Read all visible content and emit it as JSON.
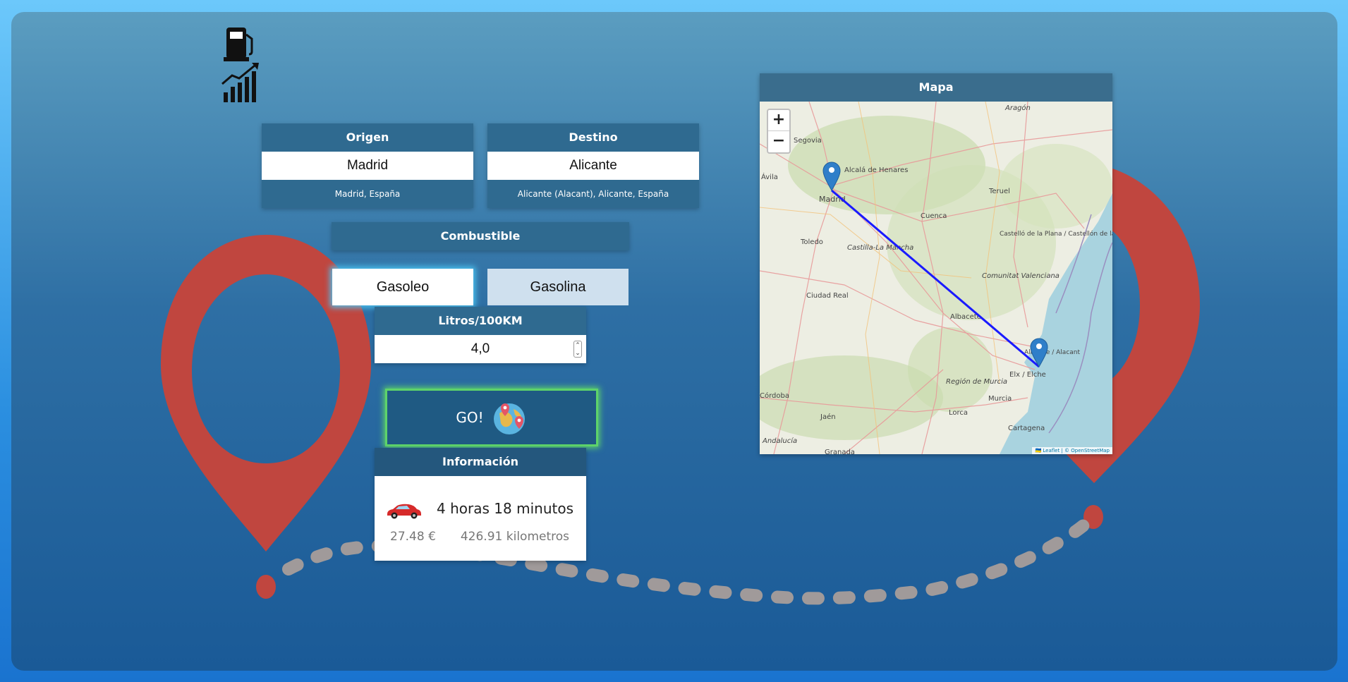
{
  "origin": {
    "heading": "Origen",
    "value": "Madrid",
    "resolved": "Madrid, España"
  },
  "destination": {
    "heading": "Destino",
    "value": "Alicante",
    "resolved": "Alicante (Alacant), Alicante, España"
  },
  "fuel": {
    "heading": "Combustible",
    "options": [
      "Gasoleo",
      "Gasolina"
    ],
    "selected": "Gasoleo"
  },
  "consumption": {
    "heading": "Litros/100KM",
    "value": "4,0"
  },
  "go": {
    "label": "GO!"
  },
  "info": {
    "heading": "Información",
    "duration": "4 horas 18 minutos",
    "cost": "27.48 €",
    "distance": "426.91 kilometros"
  },
  "map": {
    "heading": "Mapa",
    "zoom_in": "+",
    "zoom_out": "−",
    "attribution": "🇺🇦 Leaflet | © OpenStreetMap",
    "places": [
      "Aragón",
      "Segovia",
      "Alcalá de Henares",
      "Ávila",
      "Madrid",
      "Teruel",
      "Cuenca",
      "Toledo",
      "Castilla-La Mancha",
      "Castelló de la Plana / Castellón de la Plana",
      "Comunitat Valenciana",
      "Ciudad Real",
      "Albacete",
      "Alicante / Alacant",
      "Elx / Elche",
      "Región de Murcia",
      "Murcia",
      "Córdoba",
      "Jaén",
      "Lorca",
      "Cartagena",
      "Andalucía",
      "Granada"
    ]
  },
  "colors": {
    "pin_red": "#c0463f",
    "route_blue": "#1a1aff",
    "go_border": "#5ed36a",
    "header_bg": "#2f6a90"
  }
}
